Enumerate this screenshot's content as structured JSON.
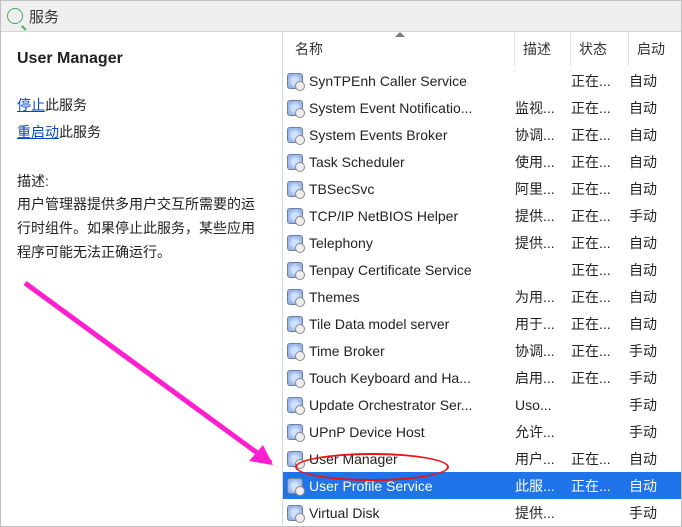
{
  "toolbar": {
    "label": "服务"
  },
  "left": {
    "title": "User Manager",
    "stop_link": "停止",
    "stop_suffix": "此服务",
    "restart_link": "重启动",
    "restart_suffix": "此服务",
    "desc_header": "描述:",
    "description": "用户管理器提供多用户交互所需要的运行时组件。如果停止此服务，某些应用程序可能无法正确运行。"
  },
  "columns": {
    "name": "名称",
    "desc": "描述",
    "status": "状态",
    "startup": "启动"
  },
  "selected_index": 15,
  "services": [
    {
      "name": "SynTPEnh Caller Service",
      "desc": "",
      "status": "正在...",
      "startup": "自动"
    },
    {
      "name": "System Event Notificatio...",
      "desc": "监视...",
      "status": "正在...",
      "startup": "自动"
    },
    {
      "name": "System Events Broker",
      "desc": "协调...",
      "status": "正在...",
      "startup": "自动"
    },
    {
      "name": "Task Scheduler",
      "desc": "使用...",
      "status": "正在...",
      "startup": "自动"
    },
    {
      "name": "TBSecSvc",
      "desc": "阿里...",
      "status": "正在...",
      "startup": "自动"
    },
    {
      "name": "TCP/IP NetBIOS Helper",
      "desc": "提供...",
      "status": "正在...",
      "startup": "手动"
    },
    {
      "name": "Telephony",
      "desc": "提供...",
      "status": "正在...",
      "startup": "自动"
    },
    {
      "name": "Tenpay Certificate Service",
      "desc": "",
      "status": "正在...",
      "startup": "自动"
    },
    {
      "name": "Themes",
      "desc": "为用...",
      "status": "正在...",
      "startup": "自动"
    },
    {
      "name": "Tile Data model server",
      "desc": "用于...",
      "status": "正在...",
      "startup": "自动"
    },
    {
      "name": "Time Broker",
      "desc": "协调...",
      "status": "正在...",
      "startup": "手动"
    },
    {
      "name": "Touch Keyboard and Ha...",
      "desc": "启用...",
      "status": "正在...",
      "startup": "手动"
    },
    {
      "name": "Update Orchestrator Ser...",
      "desc": "Uso...",
      "status": "",
      "startup": "手动"
    },
    {
      "name": "UPnP Device Host",
      "desc": "允许...",
      "status": "",
      "startup": "手动"
    },
    {
      "name": "User Manager",
      "desc": "用户...",
      "status": "正在...",
      "startup": "自动"
    },
    {
      "name": "User Profile Service",
      "desc": "此服...",
      "status": "正在...",
      "startup": "自动"
    },
    {
      "name": "Virtual Disk",
      "desc": "提供...",
      "status": "",
      "startup": "手动"
    }
  ],
  "annotation": {
    "circle": true,
    "arrow": true
  }
}
